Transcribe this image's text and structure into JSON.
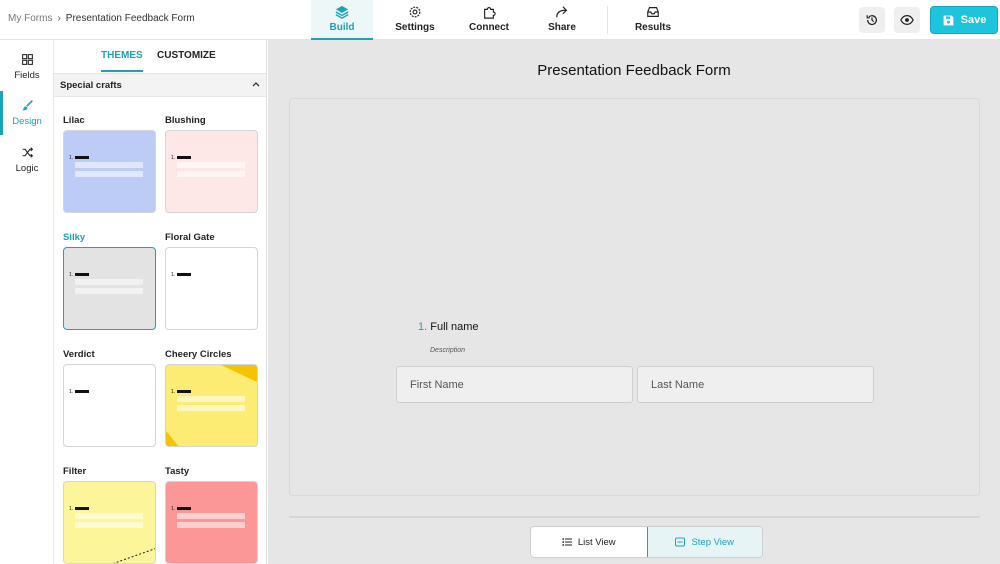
{
  "breadcrumb": {
    "root": "My Forms",
    "separator": "›",
    "current": "Presentation Feedback Form"
  },
  "nav_tabs": [
    {
      "label": "Build",
      "icon": "layers-icon",
      "active": true
    },
    {
      "label": "Settings",
      "icon": "gear-icon",
      "active": false
    },
    {
      "label": "Connect",
      "icon": "puzzle-icon",
      "active": false
    },
    {
      "label": "Share",
      "icon": "share-icon",
      "active": false
    },
    {
      "label": "Results",
      "icon": "inbox-icon",
      "active": false
    }
  ],
  "actions": {
    "history_icon": "history-icon",
    "preview_icon": "eye-icon",
    "save_label": "Save",
    "save_icon": "save-icon"
  },
  "left_rail": [
    {
      "label": "Fields",
      "icon": "grid-icon",
      "active": false
    },
    {
      "label": "Design",
      "icon": "brush-icon",
      "active": true
    },
    {
      "label": "Logic",
      "icon": "shuffle-icon",
      "active": false
    }
  ],
  "panel": {
    "tabs": [
      {
        "label": "THEMES",
        "active": true
      },
      {
        "label": "CUSTOMIZE",
        "active": false
      }
    ],
    "section_title": "Special crafts",
    "themes": [
      {
        "name": "Lilac",
        "selected": false,
        "bg": "#bcccf7",
        "lines": true
      },
      {
        "name": "Blushing",
        "selected": false,
        "bg": "#fde8e7",
        "lines": true
      },
      {
        "name": "Silky",
        "selected": true,
        "bg": "#e3e3e3",
        "lines": true
      },
      {
        "name": "Floral Gate",
        "selected": false,
        "bg": "#ffffff",
        "lines": false
      },
      {
        "name": "Verdict",
        "selected": false,
        "bg": "#ffffff",
        "lines": false
      },
      {
        "name": "Cheery Circles",
        "selected": false,
        "bg": "#fdec74",
        "lines": true
      },
      {
        "name": "Filter",
        "selected": false,
        "bg": "#fdf59a",
        "lines": true
      },
      {
        "name": "Tasty",
        "selected": false,
        "bg": "#fb9797",
        "lines": true
      }
    ],
    "theme_number": "1."
  },
  "form": {
    "title": "Presentation Feedback Form",
    "question_number": "1.",
    "question_label": "Full name",
    "description": "Description",
    "first_name_placeholder": "First Name",
    "last_name_placeholder": "Last Name"
  },
  "view_toggle": {
    "list_label": "List View",
    "step_label": "Step View",
    "active": "step"
  },
  "colors": {
    "accent": "#1aa3b9",
    "save_button": "#1ec3dd"
  }
}
